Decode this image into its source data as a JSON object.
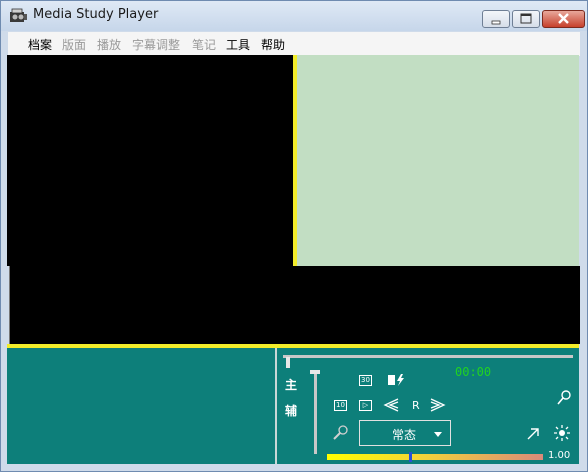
{
  "window": {
    "title": "Media Study Player"
  },
  "menu": [
    {
      "label": "档案",
      "enabled": true
    },
    {
      "label": "版面",
      "enabled": false
    },
    {
      "label": "播放",
      "enabled": false
    },
    {
      "label": "字幕调整",
      "enabled": false
    },
    {
      "label": "笔记",
      "enabled": false
    },
    {
      "label": "工具",
      "enabled": true
    },
    {
      "label": "帮助",
      "enabled": true
    }
  ],
  "controls": {
    "time": "00:00",
    "main_label": "主",
    "aux_label": "辅",
    "repeat_label": "R",
    "mode_label": "常态",
    "speed_value": "1.00"
  },
  "colors": {
    "panel": "#0d7f7a",
    "notes_area": "#c2dec3",
    "splitter": "#f2ec2a",
    "time_text": "#21d321"
  },
  "icons": [
    "app-icon",
    "minimize-icon",
    "maximize-icon",
    "close-icon",
    "repeat-a-icon",
    "bookmark-flash-icon",
    "back-icon",
    "forward-icon",
    "rewind-icon",
    "fast-forward-icon",
    "magnifier-icon",
    "pin-icon",
    "expand-icon",
    "brightness-icon"
  ]
}
